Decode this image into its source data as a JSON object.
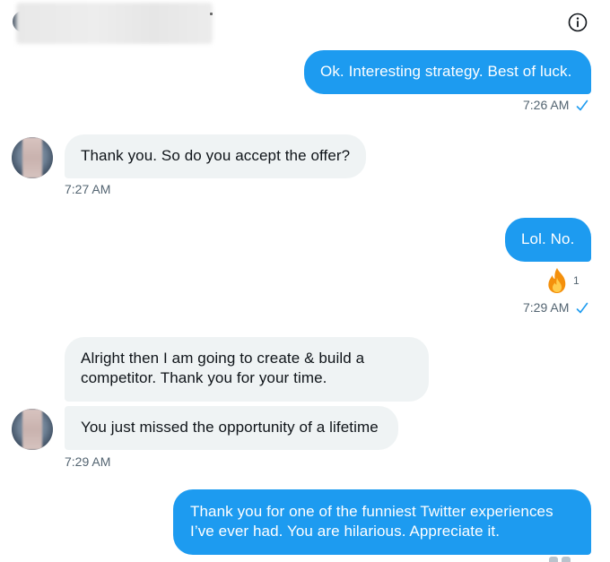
{
  "conversation": {
    "header": {
      "info_icon": "info-circle-icon"
    },
    "messages": [
      {
        "id": "m1",
        "direction": "outgoing",
        "text": "Ok. Interesting strategy. Best of luck.",
        "time": "7:26 AM",
        "read_receipt": "check-icon"
      },
      {
        "id": "m2",
        "direction": "incoming",
        "text": "Thank you. So do you accept the offer?",
        "time": "7:27 AM"
      },
      {
        "id": "m3",
        "direction": "outgoing",
        "text": "Lol. No.",
        "time": "7:29 AM",
        "read_receipt": "check-icon",
        "reaction": {
          "emoji": "fire-emoji",
          "count": "1"
        }
      },
      {
        "id": "m4",
        "direction": "incoming",
        "text": "Alright then I am going to create & build a competitor. Thank you for your time."
      },
      {
        "id": "m5",
        "direction": "incoming",
        "text": "You just missed the opportunity of a lifetime",
        "time": "7:29 AM"
      },
      {
        "id": "m6",
        "direction": "outgoing",
        "text": "Thank you for one of the funniest Twitter experiences I’ve ever had. You are hilarious. Appreciate it."
      }
    ]
  },
  "colors": {
    "outgoing_bubble": "#1d9bf0",
    "incoming_bubble": "#eff3f4",
    "timestamp": "#536471",
    "check": "#1d9bf0"
  }
}
